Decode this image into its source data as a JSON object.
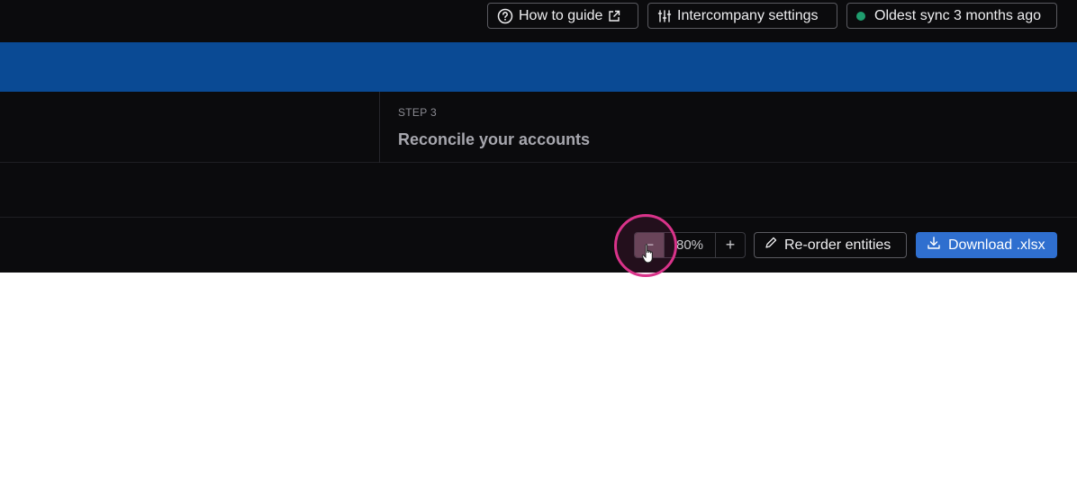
{
  "topbar": {
    "guide_label": "How to guide",
    "settings_label": "Intercompany settings",
    "sync_label": "Oldest sync 3 months ago",
    "sync_status_color": "#1f9d6e"
  },
  "steps": {
    "step3_label": "STEP 3",
    "step3_title": "Reconcile your accounts"
  },
  "toolbar": {
    "zoom_value": "80%",
    "zoom_minus": "−",
    "zoom_plus": "+",
    "reorder_label": "Re-order entities",
    "download_label": "Download .xlsx"
  },
  "colors": {
    "accent_band": "#0a4a94",
    "primary_button": "#2f6fcf",
    "cursor_highlight": "#d9338a"
  },
  "icons": {
    "guide": "question-circle-icon",
    "external": "external-link-icon",
    "settings": "sliders-icon",
    "reorder": "pencil-icon",
    "download": "download-icon"
  }
}
